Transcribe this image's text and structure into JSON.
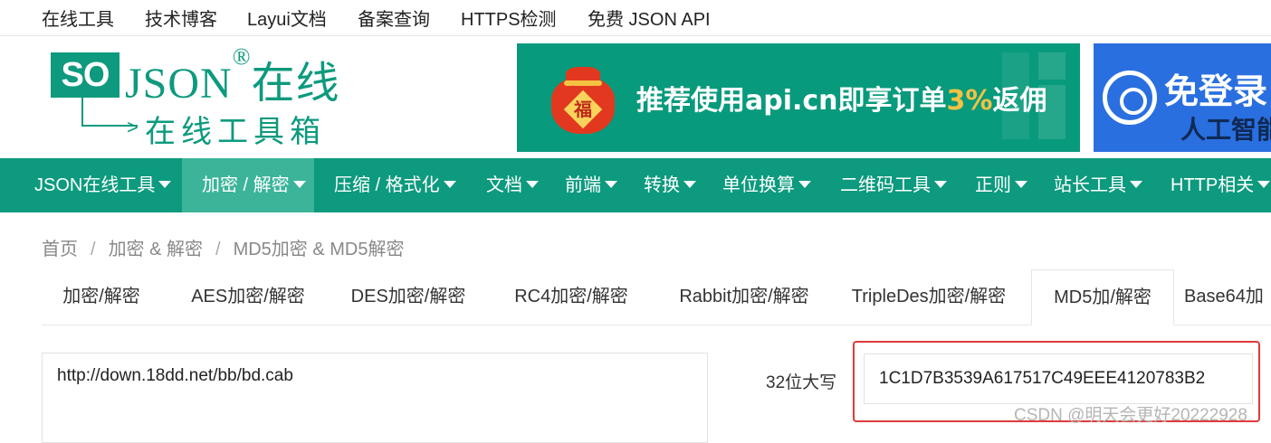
{
  "top_links": [
    "在线工具",
    "技术博客",
    "Layui文档",
    "备案查询",
    "HTTPS检测",
    "免费 JSON API"
  ],
  "logo": {
    "mark": "SO",
    "name": "JSON",
    "registered": "®",
    "suffix": "在线",
    "subtitle": "在线工具箱"
  },
  "banners": {
    "promo_prefix": "推荐使用api.cn即享订单",
    "promo_highlight": "3%",
    "promo_suffix": "返佣",
    "fu_char": "福",
    "side_line1": "免登录",
    "side_line2": "人工智能"
  },
  "nav": {
    "items": [
      "JSON在线工具",
      "加密 / 解密",
      "压缩 / 格式化",
      "文档",
      "前端",
      "转换",
      "单位换算",
      "二维码工具",
      "正则",
      "站长工具",
      "HTTP相关"
    ],
    "active_index": 1
  },
  "breadcrumb": [
    "首页",
    "加密 & 解密",
    "MD5加密 & MD5解密"
  ],
  "tabs": {
    "items": [
      "加密/解密",
      "AES加密/解密",
      "DES加密/解密",
      "RC4加密/解密",
      "Rabbit加密/解密",
      "TripleDes加密/解密",
      "MD5加/解密",
      "Base64加"
    ],
    "active_index": 6
  },
  "input": {
    "value": "http://down.18dd.net/bb/bd.cab"
  },
  "result": {
    "label": "32位大写",
    "value": "1C1D7B3539A617517C49EEE4120783B2"
  },
  "watermark": "CSDN @明天会更好20222928",
  "colors": {
    "brand": "#0d9a7e",
    "nav_active": "#3bb49a",
    "highlight_box": "#e03a3a",
    "banner_blue": "#2a6fe0"
  }
}
